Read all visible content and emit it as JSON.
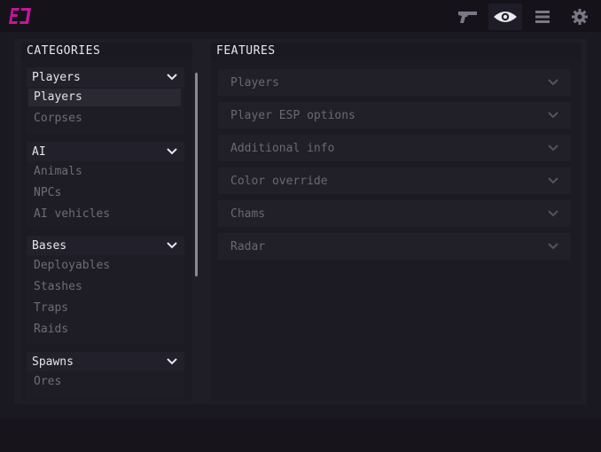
{
  "topbar": {
    "icons": [
      "gun-icon",
      "eye-icon",
      "menu-icon",
      "gear-icon"
    ],
    "active": "eye-icon"
  },
  "categories": {
    "title": "CATEGORIES",
    "groups": [
      {
        "label": "Players",
        "items": [
          "Players",
          "Corpses"
        ],
        "selected": "Players"
      },
      {
        "label": "AI",
        "items": [
          "Animals",
          "NPCs",
          "AI vehicles"
        ]
      },
      {
        "label": "Bases",
        "items": [
          "Deployables",
          "Stashes",
          "Traps",
          "Raids"
        ]
      },
      {
        "label": "Spawns",
        "items": [
          "Ores"
        ]
      }
    ]
  },
  "features": {
    "title": "FEATURES",
    "items": [
      "Players",
      "Player ESP options",
      "Additional info",
      "Color override",
      "Chams",
      "Radar"
    ]
  },
  "colors": {
    "accent": "#c0179a",
    "background": "#1a1820",
    "panel": "#1c1a22"
  }
}
